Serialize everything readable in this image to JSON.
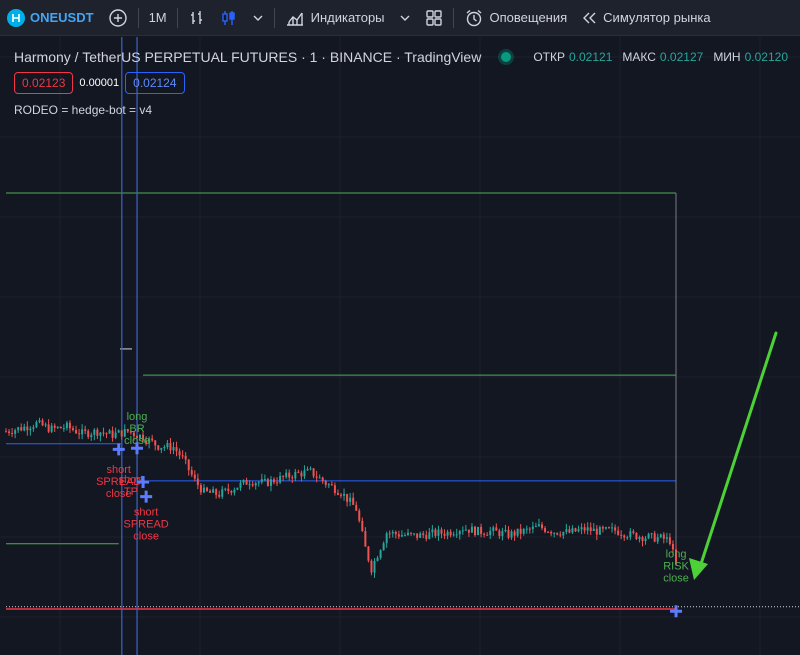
{
  "toolbar": {
    "symbol": "ONEUSDT",
    "interval": "1M",
    "indicators_label": "Индикаторы",
    "alerts_label": "Оповещения",
    "replay_label": "Симулятор рынка"
  },
  "legend": {
    "title": "Harmony / TetherUS PERPETUAL FUTURES · 1 · BINANCE · TradingView",
    "open_label": "ОТКР",
    "open_value": "0.02121",
    "high_label": "МАКС",
    "high_value": "0.02127",
    "low_label": "МИН",
    "low_value": "0.02120",
    "sell_price": "0.02123",
    "spread": "0.00001",
    "buy_price": "0.02124",
    "indicator": "RODEO = hedge-bot = v4"
  },
  "colors": {
    "background": "#131722",
    "up": "#26a69a",
    "down": "#ef5350",
    "green_line": "#4caf50",
    "blue_line": "#2962ff",
    "red_line": "#f23645",
    "label_green": "#4caf50",
    "label_red": "#f23645",
    "arrow": "#4cd137"
  },
  "chart_data": {
    "type": "candlestick",
    "title": "Harmony / TetherUS PERPETUAL FUTURES · 1 · BINANCE · TradingView",
    "grid": true,
    "series_outline": [
      [
        0,
        0.0228
      ],
      [
        5,
        0.02283
      ],
      [
        10,
        0.02287
      ],
      [
        15,
        0.02282
      ],
      [
        20,
        0.02284
      ],
      [
        25,
        0.02278
      ],
      [
        30,
        0.0228
      ],
      [
        35,
        0.02277
      ],
      [
        40,
        0.0228
      ],
      [
        45,
        0.02275
      ],
      [
        50,
        0.02267
      ],
      [
        55,
        0.02266
      ],
      [
        58,
        0.02256
      ],
      [
        60,
        0.02246
      ],
      [
        62,
        0.02236
      ],
      [
        65,
        0.02226
      ],
      [
        70,
        0.02224
      ],
      [
        75,
        0.0223
      ],
      [
        80,
        0.02236
      ],
      [
        85,
        0.02234
      ],
      [
        90,
        0.02238
      ],
      [
        95,
        0.02242
      ],
      [
        100,
        0.02244
      ],
      [
        105,
        0.02234
      ],
      [
        110,
        0.02226
      ],
      [
        115,
        0.02211
      ],
      [
        118,
        0.02176
      ],
      [
        120,
        0.02158
      ],
      [
        125,
        0.0219
      ],
      [
        130,
        0.02188
      ],
      [
        135,
        0.02187
      ],
      [
        140,
        0.02189
      ],
      [
        145,
        0.0219
      ],
      [
        150,
        0.02194
      ],
      [
        155,
        0.02191
      ],
      [
        160,
        0.02191
      ],
      [
        165,
        0.02188
      ],
      [
        170,
        0.02191
      ],
      [
        175,
        0.02195
      ],
      [
        180,
        0.02191
      ],
      [
        185,
        0.0219
      ],
      [
        190,
        0.02193
      ],
      [
        195,
        0.02191
      ],
      [
        200,
        0.02192
      ],
      [
        205,
        0.02188
      ],
      [
        210,
        0.02186
      ],
      [
        215,
        0.02185
      ],
      [
        218,
        0.02183
      ],
      [
        220,
        0.0216
      ]
    ],
    "horizontal_lines": [
      {
        "color": "green",
        "value": 0.02492,
        "x_range": [
          0,
          220
        ]
      },
      {
        "color": "green",
        "value": 0.0233,
        "x_range": [
          45,
          220
        ]
      },
      {
        "color": "green",
        "value": 0.0218,
        "x_range": [
          0,
          37
        ]
      },
      {
        "color": "blue",
        "value": 0.02269,
        "x_range": [
          0,
          38
        ]
      },
      {
        "color": "blue",
        "value": 0.02236,
        "x_range": [
          47,
          220
        ]
      },
      {
        "color": "red",
        "value": 0.02122,
        "x_range": [
          0,
          220
        ]
      },
      {
        "color": "white-dotted",
        "value": 0.02124,
        "x_range": [
          0,
          260
        ]
      }
    ],
    "vertical_lines": [
      40,
      45
    ],
    "signals": [
      {
        "text": "long\nBR\nclose",
        "color": "green",
        "x": 44,
        "price": 0.0229
      },
      {
        "text": "short\nSPREAD\nclose",
        "color": "red",
        "x": 38,
        "price": 0.02243
      },
      {
        "text": "short\nTP",
        "color": "red",
        "x": 42,
        "price": 0.02234
      },
      {
        "text": "short\nSPREAD\nclose",
        "color": "red",
        "x": 47,
        "price": 0.02205
      },
      {
        "text": "long\nRISK\nclose",
        "color": "green",
        "x": 221,
        "price": 0.02168
      }
    ],
    "markers": [
      {
        "x": 38,
        "price": 0.02264
      },
      {
        "x": 44,
        "price": 0.02265
      },
      {
        "x": 46,
        "price": 0.02235
      },
      {
        "x": 47,
        "price": 0.02222
      },
      {
        "x": 221,
        "price": 0.0212
      }
    ]
  }
}
